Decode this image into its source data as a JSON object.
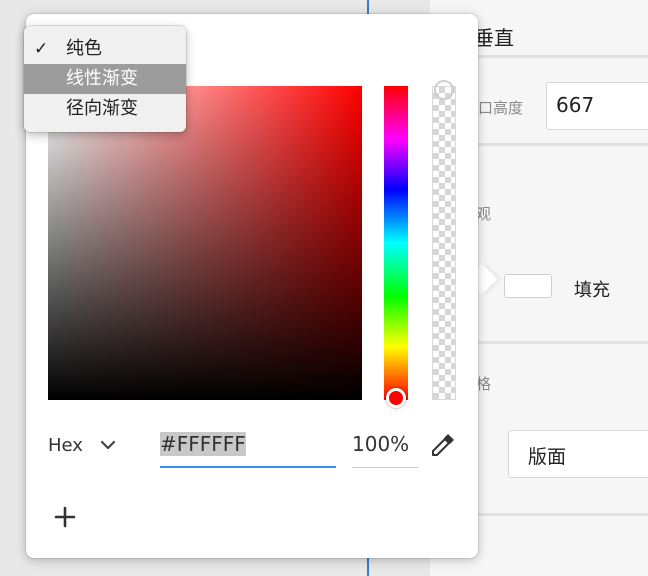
{
  "inspector": {
    "align_label": "垂直",
    "height_label": "口高度",
    "height_value": "667",
    "appearance_label": "观",
    "fill_label": "填充",
    "style_label": "格",
    "style_value": "版面"
  },
  "menu": {
    "items": [
      {
        "label": "纯色",
        "checked": true
      },
      {
        "label": "线性渐变",
        "checked": false
      },
      {
        "label": "径向渐变",
        "checked": false
      }
    ],
    "check_glyph": "✓"
  },
  "picker": {
    "format_label": "Hex",
    "hex_value": "#FFFFFF",
    "opacity_value": "100%"
  },
  "colors": {
    "accent": "#3a8ee6",
    "selected_fill": "#FFFFFF",
    "hue": "#ff0000"
  },
  "icons": {
    "format_dropdown": "chevron-down-icon",
    "eyedropper": "eyedropper-icon",
    "add": "plus-icon"
  }
}
